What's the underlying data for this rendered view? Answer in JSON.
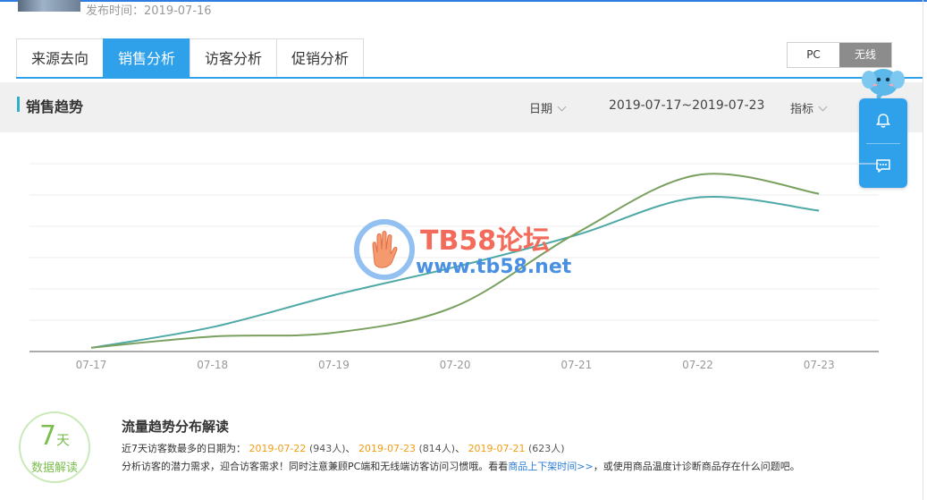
{
  "header": {
    "publish_label": "发布时间：2019-07-16"
  },
  "tabs": [
    {
      "label": "来源去向",
      "active": false
    },
    {
      "label": "销售分析",
      "active": true
    },
    {
      "label": "访客分析",
      "active": false
    },
    {
      "label": "促销分析",
      "active": false
    }
  ],
  "device_switch": {
    "pc": "PC",
    "wireless": "无线",
    "selected": "无线"
  },
  "section": {
    "title": "销售趋势",
    "date_label": "日期",
    "date_range": "2019-07-17~2019-07-23",
    "metric_label": "指标"
  },
  "watermark": {
    "line1": "TB58论坛",
    "line2": "www.tb58.net"
  },
  "chart_data": {
    "type": "line",
    "categories": [
      "07-17",
      "07-18",
      "07-19",
      "07-20",
      "07-21",
      "07-22",
      "07-23"
    ],
    "series": [
      {
        "color": "#4fa9a6",
        "values": [
          2,
          13,
          30,
          45,
          62,
          82,
          75
        ]
      },
      {
        "color": "#7aa060",
        "values": [
          2,
          8,
          10,
          24,
          63,
          94,
          84
        ]
      }
    ],
    "ylim": [
      0,
      100
    ],
    "grid": true,
    "legend": "none"
  },
  "interpretation": {
    "badge_number": "7",
    "badge_unit": "天",
    "badge_label": "数据解读",
    "title": "流量趋势分布解读",
    "intro": "近7天访客数最多的日期为：",
    "top_days": [
      {
        "date": "2019-07-22",
        "count": "(943人)"
      },
      {
        "date": "2019-07-23",
        "count": "(814人)"
      },
      {
        "date": "2019-07-21",
        "count": "(623人)"
      }
    ],
    "separator": "、",
    "text_before_link": "分析访客的潜力需求，迎合访客需求！同时注意兼顾PC端和无线端访客访问习惯哦。看看",
    "link_text": "商品上下架时间>>",
    "text_after_link": "，或使用商品温度计诊断商品存在什么问题吧。"
  }
}
